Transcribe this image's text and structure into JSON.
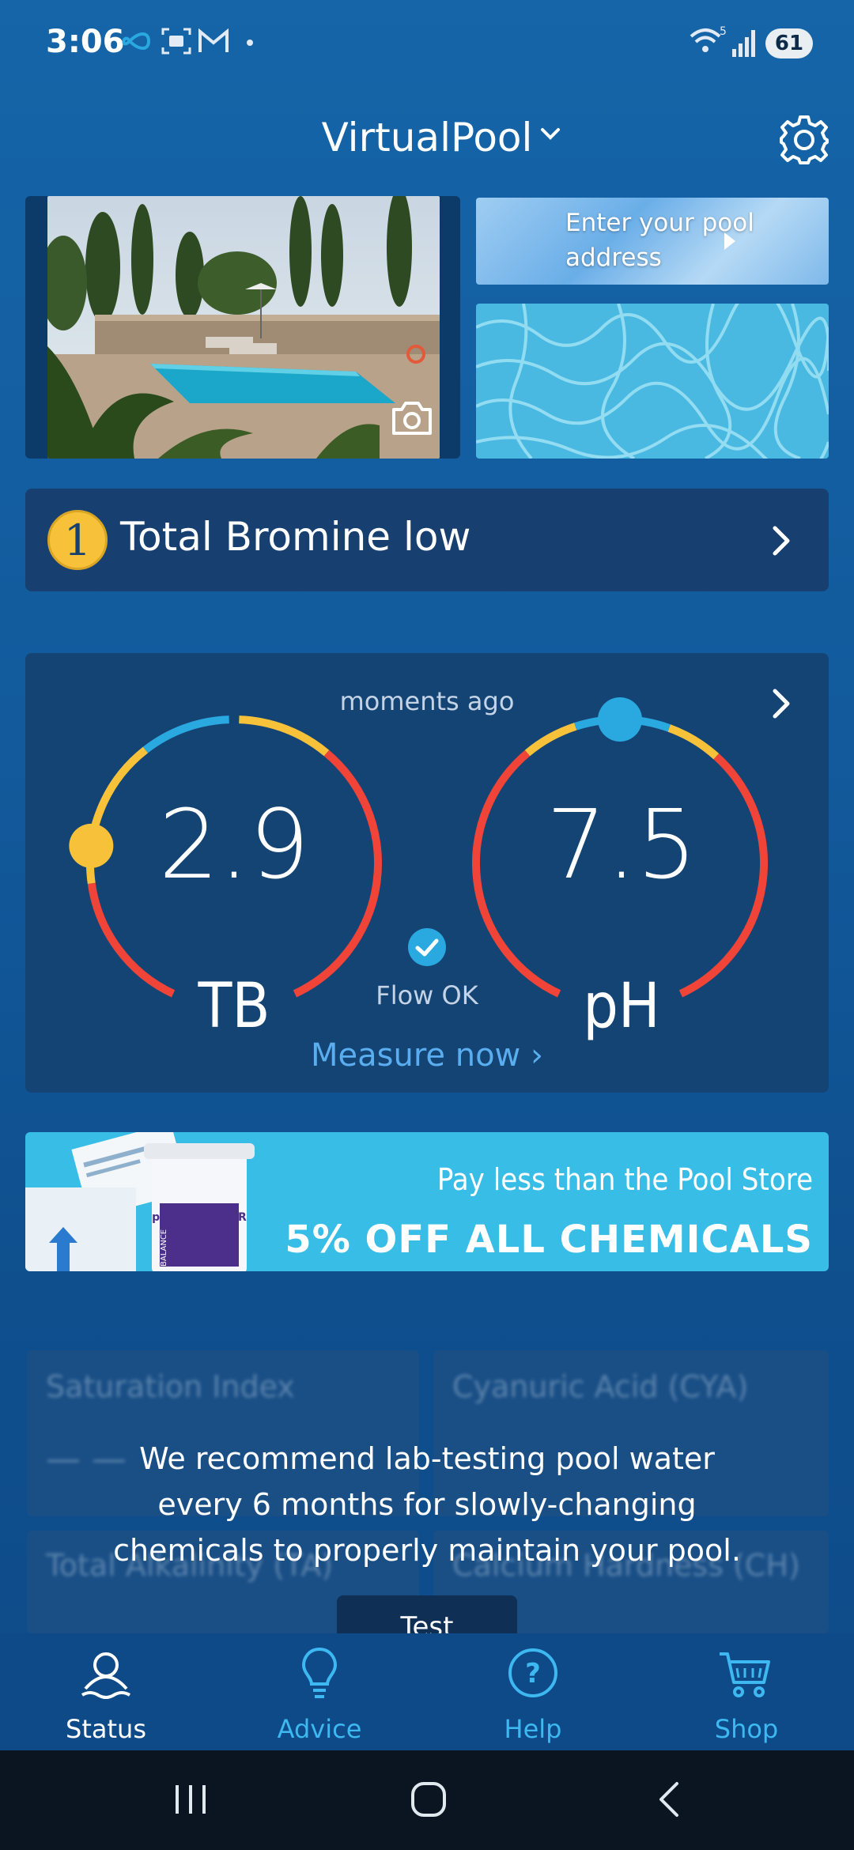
{
  "status_bar": {
    "time": "3:06",
    "battery": "61",
    "notification_icons": [
      "infinity-icon",
      "screenshot-icon",
      "gmail-icon",
      "dot-icon"
    ],
    "system_icons": [
      "wifi-icon",
      "signal-icon",
      "battery-icon"
    ]
  },
  "header": {
    "title": "VirtualPool"
  },
  "photos": {
    "address_button": "Enter your pool address"
  },
  "alert": {
    "badge": "1",
    "text": "Total Bromine low"
  },
  "readings": {
    "timestamp": "moments ago",
    "tb": {
      "value": "2.9",
      "label": "TB"
    },
    "ph": {
      "value": "7.5",
      "label": "pH"
    },
    "flow": "Flow OK",
    "measure_link": "Measure now ›"
  },
  "promo": {
    "line1": "Pay less than the Pool Store",
    "line2": "5% OFF ALL CHEMICALS",
    "product_label": "pH DECREASER",
    "product_brand": "BALANCE"
  },
  "lab_tests": {
    "cards": [
      {
        "label": "Saturation Index",
        "value": "— —"
      },
      {
        "label": "Cyanuric Acid (CYA)",
        "value": ""
      },
      {
        "label": "Total Alkalinity (TA)",
        "value": ""
      },
      {
        "label": "Calcium Hardness (CH)",
        "value": ""
      }
    ],
    "recommendation": "We recommend lab-testing pool water every 6 months for slowly-changing chemicals to properly maintain your pool.",
    "test_button": "Test"
  },
  "tabs": [
    {
      "label": "Status",
      "icon": "person-icon",
      "active": true
    },
    {
      "label": "Advice",
      "icon": "lightbulb-icon",
      "active": false
    },
    {
      "label": "Help",
      "icon": "help-icon",
      "active": false
    },
    {
      "label": "Shop",
      "icon": "cart-icon",
      "active": false
    }
  ],
  "colors": {
    "accent": "#2aa8e0",
    "warning_yellow": "#f7c23a",
    "danger_red": "#f04438",
    "tab_inactive": "#3db8f0"
  }
}
